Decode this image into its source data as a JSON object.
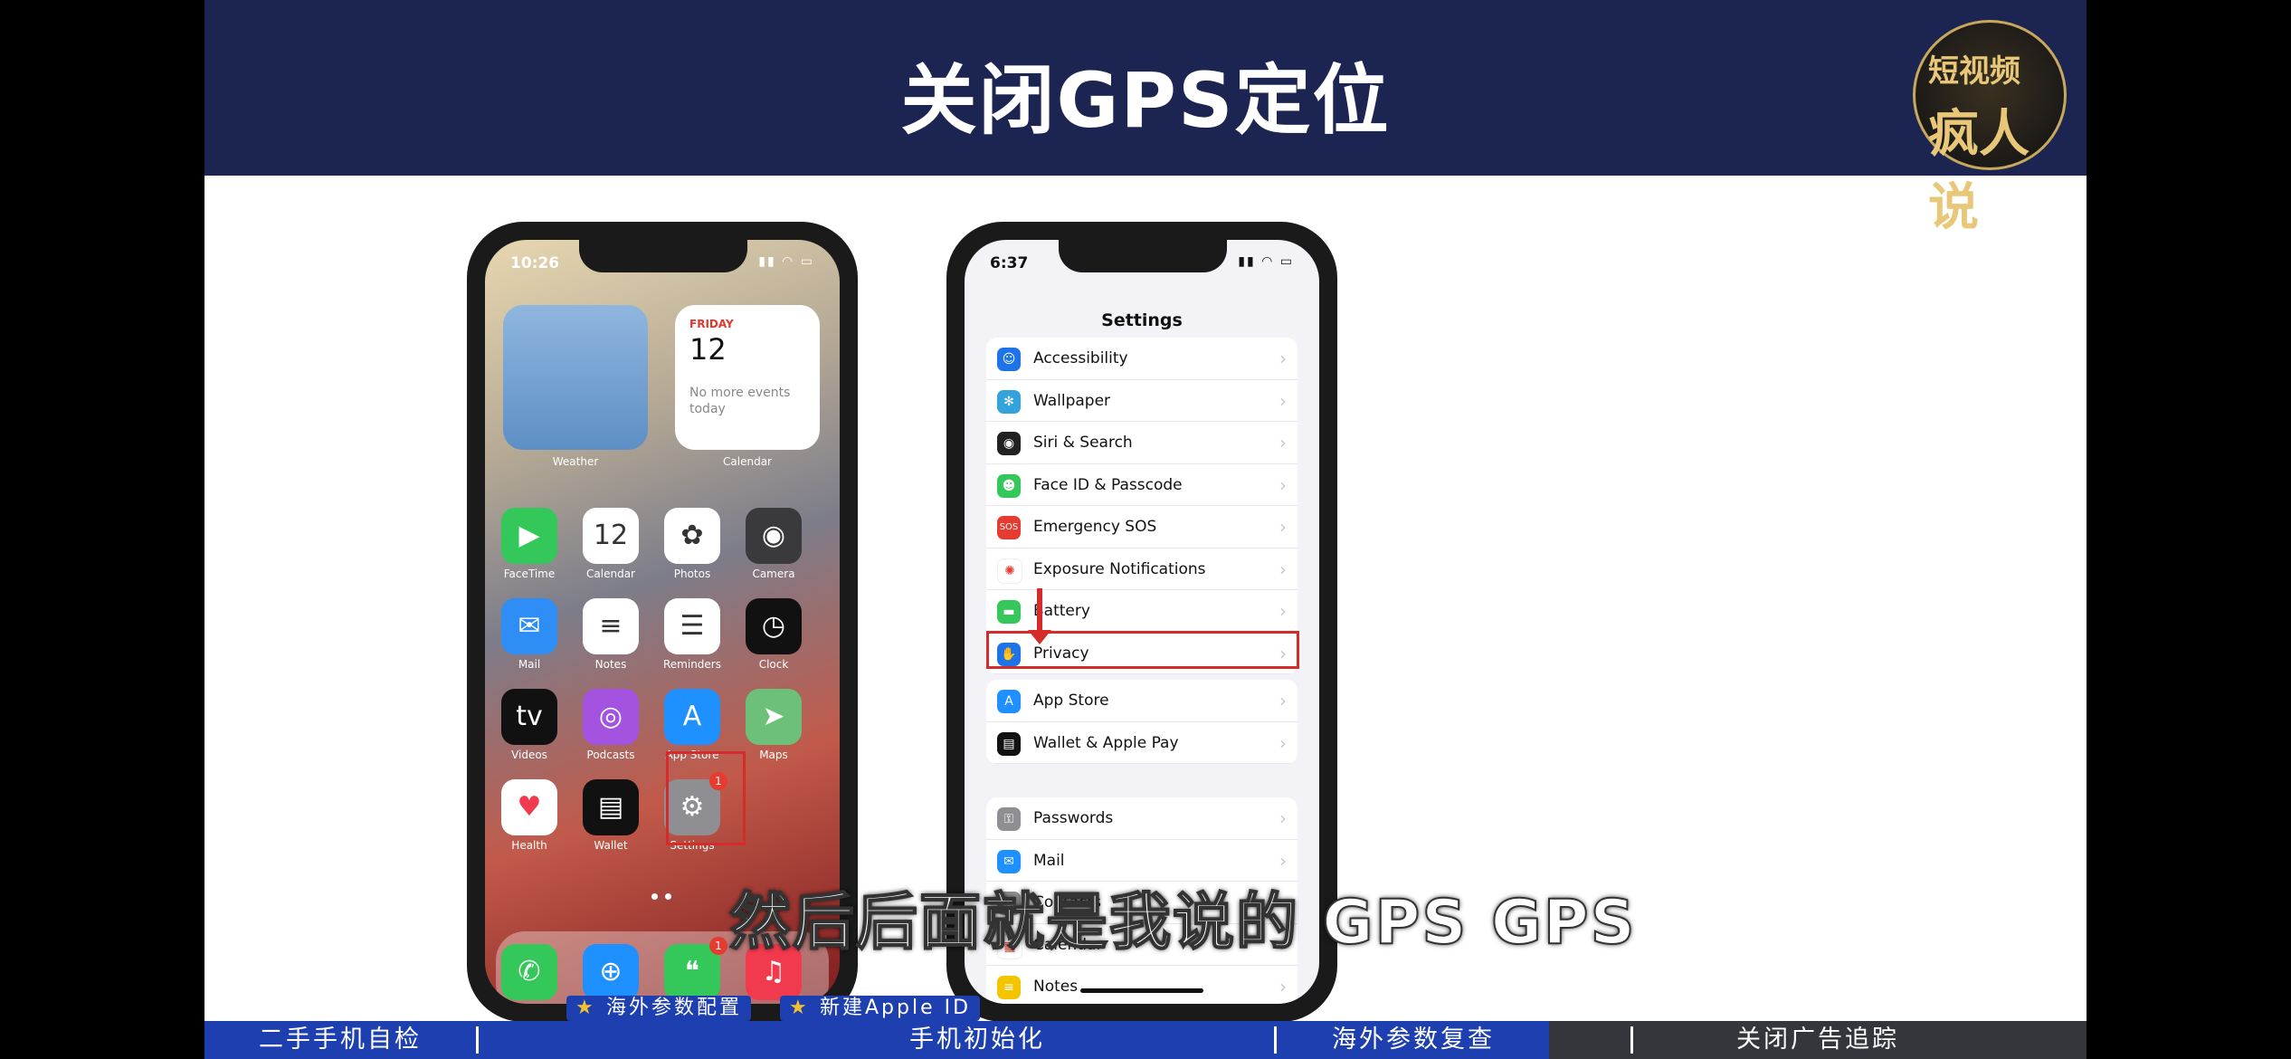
{
  "title": "关闭GPS定位",
  "logo": {
    "line1": "短视频",
    "line2": "疯人说"
  },
  "phone1": {
    "time": "10:26",
    "widgets": {
      "weather_label": "Weather",
      "calendar": {
        "day": "FRIDAY",
        "date": "12",
        "note": "No more events today",
        "label": "Calendar"
      }
    },
    "apps": [
      {
        "label": "FaceTime",
        "glyph": "▶",
        "color": "#34c759"
      },
      {
        "label": "Calendar",
        "glyph": "12",
        "color": "#ffffff"
      },
      {
        "label": "Photos",
        "glyph": "✿",
        "color": "#ffffff"
      },
      {
        "label": "Camera",
        "glyph": "◉",
        "color": "#3a3a3c"
      },
      {
        "label": "Mail",
        "glyph": "✉",
        "color": "#2e8ef5"
      },
      {
        "label": "Notes",
        "glyph": "≡",
        "color": "#ffffff"
      },
      {
        "label": "Reminders",
        "glyph": "☰",
        "color": "#ffffff"
      },
      {
        "label": "Clock",
        "glyph": "◷",
        "color": "#111111"
      },
      {
        "label": "Videos",
        "glyph": "tv",
        "color": "#111111"
      },
      {
        "label": "Podcasts",
        "glyph": "◎",
        "color": "#a452e0"
      },
      {
        "label": "App Store",
        "glyph": "A",
        "color": "#1e90ff"
      },
      {
        "label": "Maps",
        "glyph": "➤",
        "color": "#6cc07a"
      },
      {
        "label": "Health",
        "glyph": "♥",
        "color": "#ffffff"
      },
      {
        "label": "Wallet",
        "glyph": "▤",
        "color": "#111111"
      },
      {
        "label": "Settings",
        "glyph": "⚙",
        "color": "#8e8e93"
      }
    ],
    "settings_badge": "1",
    "dock": [
      {
        "glyph": "✆",
        "color": "#34c759"
      },
      {
        "glyph": "⊕",
        "color": "#1e90ff"
      },
      {
        "glyph": "❝",
        "color": "#34c759"
      },
      {
        "glyph": "♫",
        "color": "#f23a4e"
      }
    ],
    "messages_badge": "1"
  },
  "phone2": {
    "time": "6:37",
    "header": "Settings",
    "group1": [
      {
        "label": "Accessibility",
        "icon": "☺",
        "color": "#1e73e8"
      },
      {
        "label": "Wallpaper",
        "icon": "✻",
        "color": "#33a3dc"
      },
      {
        "label": "Siri & Search",
        "icon": "◉",
        "color": "#222222"
      },
      {
        "label": "Face ID & Passcode",
        "icon": "☻",
        "color": "#34c759"
      },
      {
        "label": "Emergency SOS",
        "icon": "SOS",
        "color": "#e53b30"
      },
      {
        "label": "Exposure Notifications",
        "icon": "✺",
        "color": "#ffffff"
      },
      {
        "label": "Battery",
        "icon": "▬",
        "color": "#34c759"
      },
      {
        "label": "Privacy",
        "icon": "✋",
        "color": "#1e73e8"
      }
    ],
    "group2": [
      {
        "label": "App Store",
        "icon": "A",
        "color": "#1e90ff"
      },
      {
        "label": "Wallet & Apple Pay",
        "icon": "▤",
        "color": "#111111"
      }
    ],
    "group3": [
      {
        "label": "Passwords",
        "icon": "⚿",
        "color": "#8e8e93"
      },
      {
        "label": "Mail",
        "icon": "✉",
        "color": "#1e90ff"
      },
      {
        "label": "Contacts",
        "icon": "☺",
        "color": "#8e8e93"
      },
      {
        "label": "Calendar",
        "icon": "▦",
        "color": "#ffffff"
      },
      {
        "label": "Notes",
        "icon": "≡",
        "color": "#f5c400"
      }
    ]
  },
  "subtitle": "然后后面就是我说的 GPS GPS",
  "tags": [
    {
      "text": "海外参数配置"
    },
    {
      "text": "新建Apple ID"
    }
  ],
  "bottom_nav": [
    {
      "label": "二手手机自检"
    },
    {
      "label": "手机初始化"
    },
    {
      "label": "海外参数复查"
    },
    {
      "label": "关闭广告追踪"
    }
  ]
}
